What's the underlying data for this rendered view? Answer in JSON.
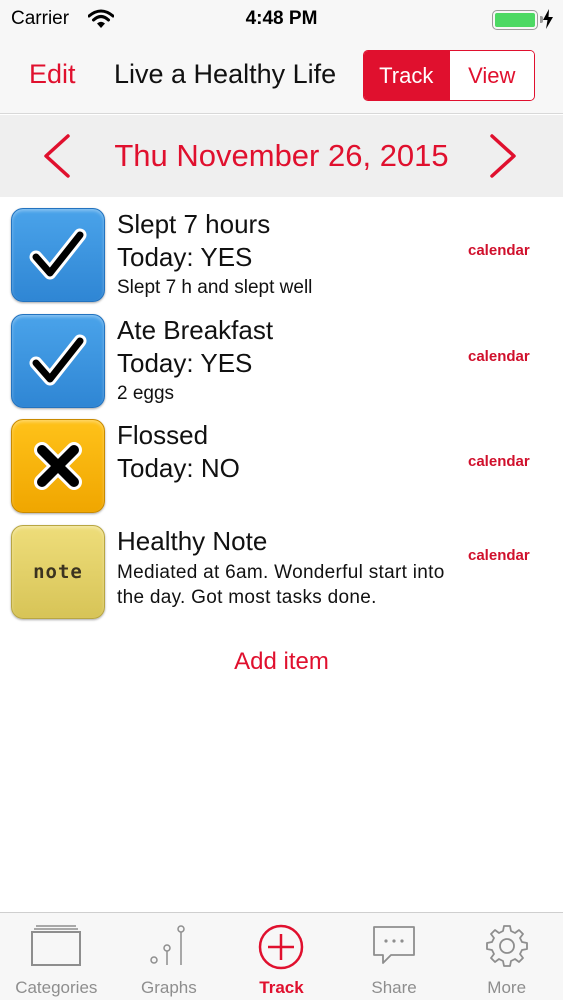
{
  "status_bar": {
    "carrier": "Carrier",
    "time": "4:48 PM",
    "battery_level": 1.0
  },
  "nav": {
    "edit_label": "Edit",
    "title": "Live a Healthy Life",
    "segments": [
      {
        "label": "Track",
        "active": true
      },
      {
        "label": "View",
        "active": false
      }
    ]
  },
  "date_bar": {
    "date": "Thu November 26, 2015"
  },
  "items": [
    {
      "icon": "checkmark-icon",
      "title": "Slept 7 hours",
      "status": "Today: YES",
      "detail": "Slept 7 h and slept well",
      "calendar_label": "calendar"
    },
    {
      "icon": "checkmark-icon",
      "title": "Ate Breakfast",
      "status": "Today: YES",
      "detail": "2 eggs",
      "calendar_label": "calendar"
    },
    {
      "icon": "x-mark-icon",
      "title": "Flossed",
      "status": "Today: NO",
      "detail": "",
      "calendar_label": "calendar"
    },
    {
      "icon": "note-icon",
      "icon_text": "note",
      "title": "Healthy Note",
      "note": "Mediated at 6am. Wonderful start into the day. Got most tasks done.",
      "calendar_label": "calendar"
    }
  ],
  "add_item_label": "Add item",
  "tabs": [
    {
      "label": "Categories",
      "icon": "categories-icon",
      "active": false
    },
    {
      "label": "Graphs",
      "icon": "graphs-icon",
      "active": false
    },
    {
      "label": "Track",
      "icon": "add-circle-icon",
      "active": true
    },
    {
      "label": "Share",
      "icon": "chat-bubble-icon",
      "active": false
    },
    {
      "label": "More",
      "icon": "gear-icon",
      "active": false
    }
  ],
  "colors": {
    "accent": "#e0102e",
    "check_blue": "#3a93df",
    "x_orange": "#f7b30a",
    "note_yellow": "#e2d068",
    "battery_green": "#4cd964"
  }
}
